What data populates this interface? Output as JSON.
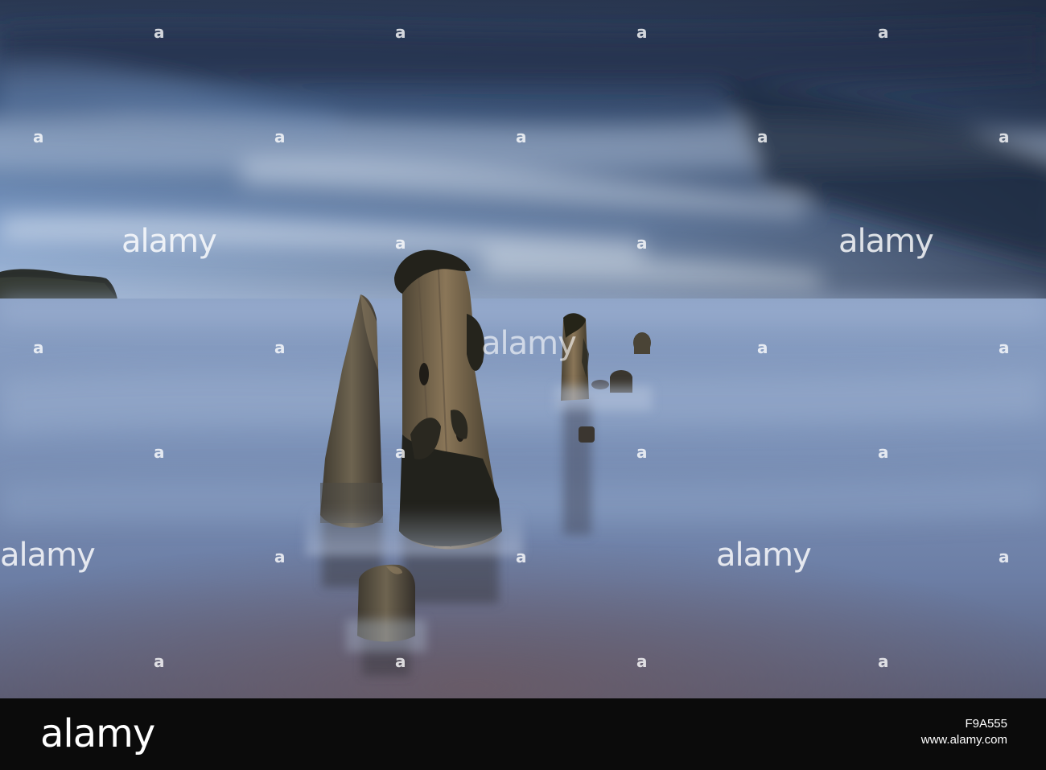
{
  "watermark": {
    "logo_text": "alamy",
    "mark_text": "a"
  },
  "footer": {
    "logo_text": "alamy",
    "image_id": "F9A555",
    "url": "www.alamy.com"
  },
  "colors": {
    "sky_dark": "#2c3b55",
    "sky_light": "#9db5d6",
    "sea_mist": "#8ea1c2",
    "sand": "#5e5668",
    "post_wood": "#7a6a52",
    "seaweed": "#2b2a22",
    "footer_bg": "#0b0b0b"
  }
}
